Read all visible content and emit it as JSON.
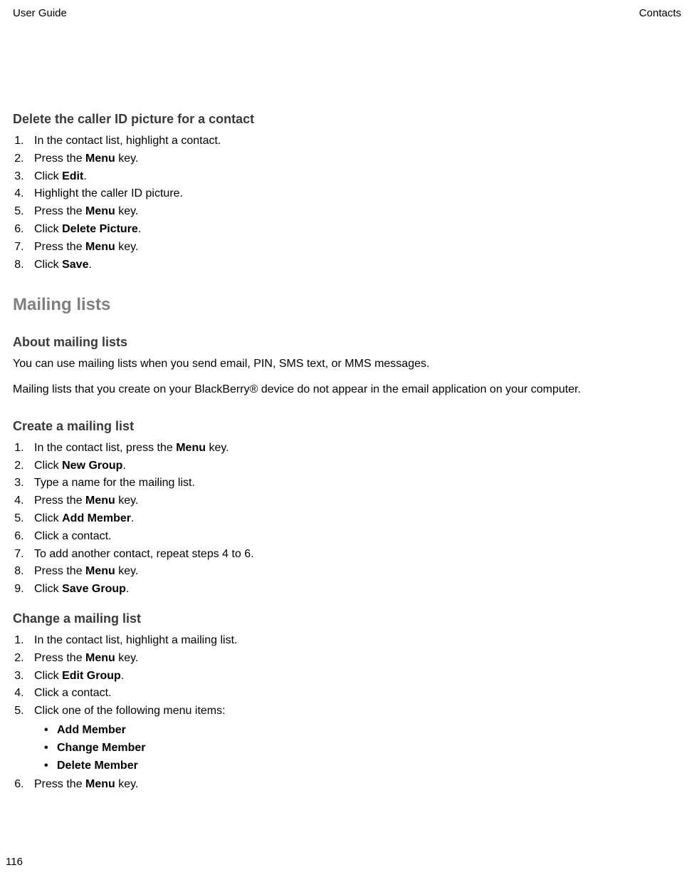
{
  "header": {
    "left": "User Guide",
    "right": "Contacts"
  },
  "page_number": "116",
  "delete_caller_id": {
    "title": "Delete the caller ID picture for a contact",
    "steps": [
      {
        "pre": "In the contact list, highlight a contact."
      },
      {
        "pre": "Press the ",
        "bold": "Menu",
        "post": " key."
      },
      {
        "pre": "Click ",
        "bold": "Edit",
        "post": "."
      },
      {
        "pre": "Highlight the caller ID picture."
      },
      {
        "pre": "Press the ",
        "bold": "Menu",
        "post": " key."
      },
      {
        "pre": "Click ",
        "bold": "Delete Picture",
        "post": "."
      },
      {
        "pre": "Press the ",
        "bold": "Menu",
        "post": " key."
      },
      {
        "pre": "Click ",
        "bold": "Save",
        "post": "."
      }
    ]
  },
  "mailing_lists": {
    "section_title": "Mailing lists",
    "about": {
      "title": "About mailing lists",
      "p1": "You can use mailing lists when you send email, PIN, SMS text, or MMS messages.",
      "p2": "Mailing lists that you create on your BlackBerry® device do not appear in the email application on your computer."
    },
    "create": {
      "title": "Create a mailing list",
      "steps": [
        {
          "pre": "In the contact list, press the ",
          "bold": "Menu",
          "post": " key."
        },
        {
          "pre": "Click ",
          "bold": "New Group",
          "post": "."
        },
        {
          "pre": "Type a name for the mailing list."
        },
        {
          "pre": "Press the ",
          "bold": "Menu",
          "post": " key."
        },
        {
          "pre": "Click ",
          "bold": "Add Member",
          "post": "."
        },
        {
          "pre": "Click a contact."
        },
        {
          "pre": "To add another contact, repeat steps 4 to 6."
        },
        {
          "pre": "Press the ",
          "bold": "Menu",
          "post": " key."
        },
        {
          "pre": "Click ",
          "bold": "Save Group",
          "post": "."
        }
      ]
    },
    "change": {
      "title": "Change a mailing list",
      "steps_before_bullets": [
        {
          "pre": "In the contact list, highlight a mailing list."
        },
        {
          "pre": "Press the ",
          "bold": "Menu",
          "post": " key."
        },
        {
          "pre": "Click ",
          "bold": "Edit Group",
          "post": "."
        },
        {
          "pre": "Click a contact."
        },
        {
          "pre": "Click one of the following menu items:"
        }
      ],
      "bullets": [
        {
          "bold": "Add Member"
        },
        {
          "bold": "Change Member"
        },
        {
          "bold": "Delete Member"
        }
      ],
      "steps_after_bullets": [
        {
          "pre": "Press the ",
          "bold": "Menu",
          "post": " key."
        }
      ]
    }
  }
}
